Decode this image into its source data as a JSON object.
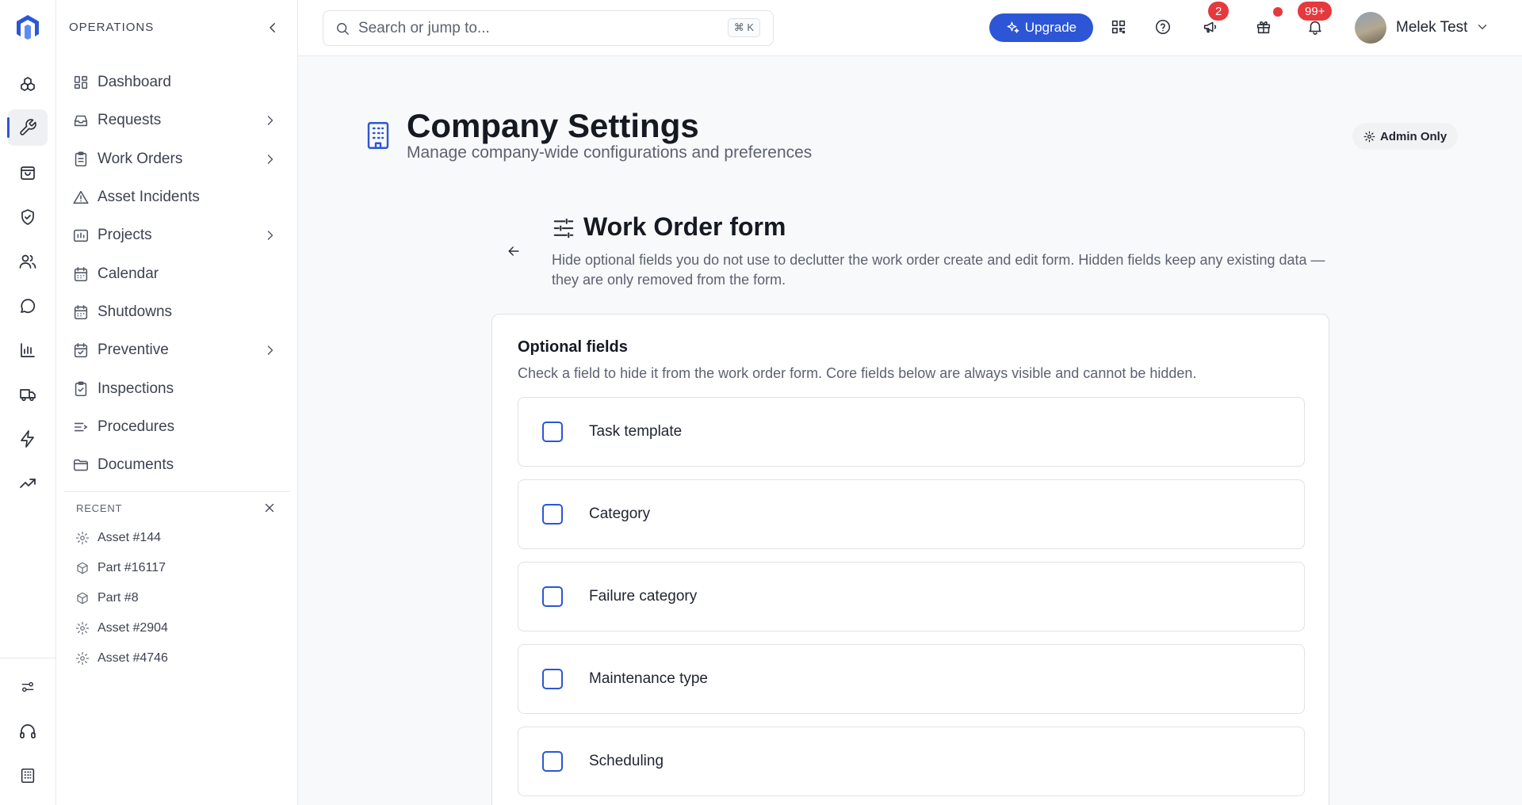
{
  "sidebar": {
    "section_title": "OPERATIONS",
    "items": [
      {
        "label": "Dashboard",
        "icon": "dashboard-icon",
        "has_children": false
      },
      {
        "label": "Requests",
        "icon": "inbox-icon",
        "has_children": true
      },
      {
        "label": "Work Orders",
        "icon": "clipboard-icon",
        "has_children": true
      },
      {
        "label": "Asset Incidents",
        "icon": "warning-icon",
        "has_children": false
      },
      {
        "label": "Projects",
        "icon": "projects-icon",
        "has_children": true
      },
      {
        "label": "Calendar",
        "icon": "calendar-icon",
        "has_children": false
      },
      {
        "label": "Shutdowns",
        "icon": "calendar-icon",
        "has_children": false
      },
      {
        "label": "Preventive",
        "icon": "calendar-check-icon",
        "has_children": true
      },
      {
        "label": "Inspections",
        "icon": "clipboard-check-icon",
        "has_children": false
      },
      {
        "label": "Procedures",
        "icon": "list-icon",
        "has_children": false
      },
      {
        "label": "Documents",
        "icon": "folder-icon",
        "has_children": false
      }
    ],
    "recent_title": "RECENT",
    "recent": [
      {
        "label": "Asset #144",
        "icon": "gear-icon"
      },
      {
        "label": "Part #16117",
        "icon": "cube-icon"
      },
      {
        "label": "Part #8",
        "icon": "cube-icon"
      },
      {
        "label": "Asset #2904",
        "icon": "gear-icon"
      },
      {
        "label": "Asset #4746",
        "icon": "gear-icon"
      }
    ]
  },
  "header": {
    "search_placeholder": "Search or jump to...",
    "search_shortcut": "⌘ K",
    "upgrade_label": "Upgrade",
    "announcements_badge": "2",
    "notifications_badge": "99+",
    "user_name": "Melek Test",
    "accent_color": "#2c56d6",
    "badge_color": "#e5393d"
  },
  "page": {
    "title": "Company Settings",
    "subtitle": "Manage company-wide configurations and preferences",
    "admin_badge": "Admin Only"
  },
  "section": {
    "title": "Work Order form",
    "description": "Hide optional fields you do not use to declutter the work order create and edit form. Hidden fields keep any existing data — they are only removed from the form.",
    "card_title": "Optional fields",
    "card_description": "Check a field to hide it from the work order form. Core fields below are always visible and cannot be hidden.",
    "fields": [
      {
        "label": "Task template",
        "checked": false
      },
      {
        "label": "Category",
        "checked": false
      },
      {
        "label": "Failure category",
        "checked": false
      },
      {
        "label": "Maintenance type",
        "checked": false
      },
      {
        "label": "Scheduling",
        "checked": false
      }
    ]
  }
}
